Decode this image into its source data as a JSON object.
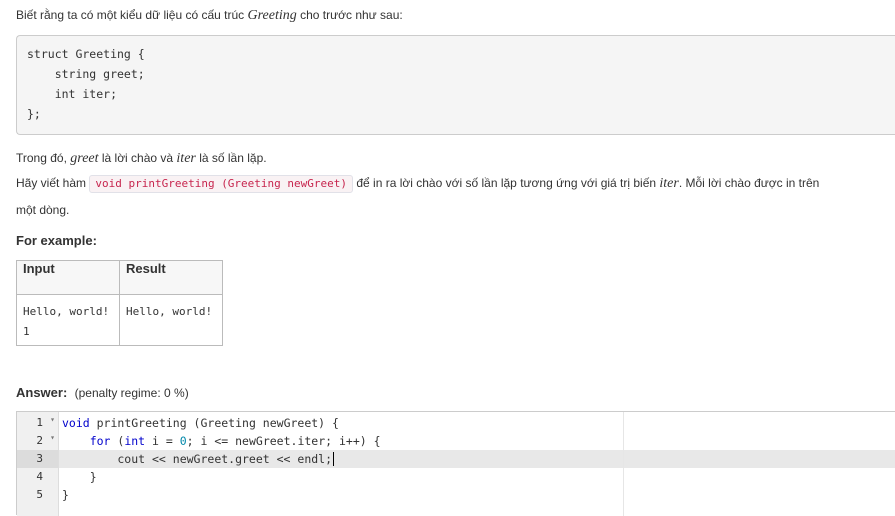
{
  "intro": {
    "pre": "Biết rằng ta có một kiểu dữ liệu có cấu trúc ",
    "struct_name": "Greeting",
    "post": " cho trước như sau:"
  },
  "struct_code": [
    "struct Greeting {",
    "    string greet;",
    "    int iter;",
    "};"
  ],
  "desc1": {
    "pre": "Trong đó, ",
    "var1": "greet",
    "mid": " là lời chào và ",
    "var2": "iter",
    "post": " là số lần lặp."
  },
  "desc2": {
    "pre": "Hãy viết hàm ",
    "func": "void printGreeting (Greeting newGreet)",
    "mid": " để in ra lời chào với số lần lặp tương ứng với giá trị biến ",
    "var": "iter",
    "post": ". Mỗi lời chào được in trên",
    "line2": "một dòng."
  },
  "example_heading": "For example:",
  "example_table": {
    "headers": [
      "Input",
      "Result"
    ],
    "input": "Hello, world!\n1",
    "result": "Hello, world!"
  },
  "answer": {
    "label": "Answer:",
    "penalty": "(penalty regime: 0 %)"
  },
  "editor": {
    "line_numbers": [
      "1",
      "2",
      "3",
      "4",
      "5"
    ],
    "fold_marker": "▾",
    "lines": [
      [
        "void",
        " printGreeting (Greeting newGreet) {"
      ],
      [
        "    for",
        " (",
        "int",
        " i = ",
        "0",
        "; i <= newGreet.iter; i++) {"
      ],
      [
        "        cout << newGreet.greet << endl;"
      ],
      [
        "    }"
      ],
      [
        "}"
      ]
    ],
    "active_line": 3
  },
  "colors": {
    "keyword": "#0000cc",
    "number": "#0088aa",
    "inline_code": "#c7254e"
  }
}
